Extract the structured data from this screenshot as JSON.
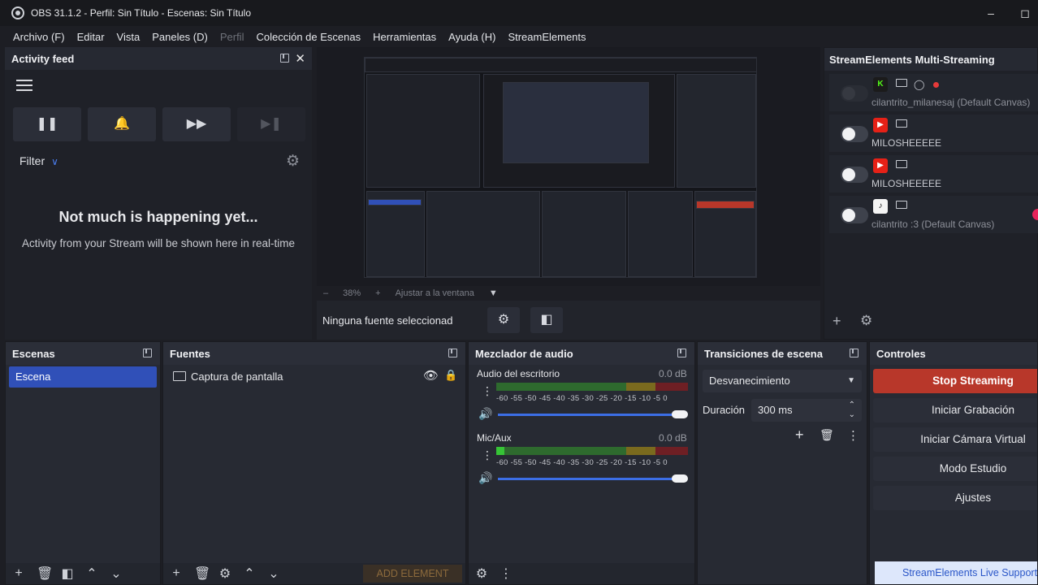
{
  "window": {
    "title": "OBS 31.1.2 - Perfil: Sin Título - Escenas: Sin Título"
  },
  "menu": [
    "Archivo (F)",
    "Editar",
    "Vista",
    "Paneles (D)",
    "Perfil",
    "Colección de Escenas",
    "Herramientas",
    "Ayuda (H)",
    "StreamElements"
  ],
  "activity": {
    "title": "Activity feed",
    "filter_label": "Filter",
    "empty_title": "Not much is happening yet...",
    "empty_sub": "Activity from your Stream will be shown here in real-time"
  },
  "preview": {
    "zoom": "38%",
    "fit": "Ajustar a la ventana",
    "no_source": "Ninguna fuente seleccionada"
  },
  "multistream": {
    "title": "StreamElements Multi-Streaming",
    "rows": [
      {
        "name": "cilantrito_milanesaj (Default Canvas)",
        "platform": "kick",
        "enabled": false
      },
      {
        "name": "MILOSHEEEEE",
        "platform": "youtube",
        "enabled": true
      },
      {
        "name": "MILOSHEEEEE",
        "platform": "youtube",
        "enabled": true
      },
      {
        "name": "cilantrito :3 (Default Canvas)",
        "platform": "tiktok",
        "enabled": true
      }
    ]
  },
  "scenes": {
    "title": "Escenas",
    "items": [
      "Escena"
    ]
  },
  "sources": {
    "title": "Fuentes",
    "items": [
      "Captura de pantalla"
    ],
    "add_element": "ADD ELEMENT"
  },
  "mixer": {
    "title": "Mezclador de audio",
    "channels": [
      {
        "name": "Audio del escritorio",
        "db": "0.0 dB",
        "level": 0.0
      },
      {
        "name": "Mic/Aux",
        "db": "0.0 dB",
        "level": 0.04
      }
    ],
    "scale": "-60 -55 -50 -45 -40 -35 -30 -25 -20 -15 -10 -5 0"
  },
  "transitions": {
    "title": "Transiciones de escena",
    "type": "Desvanecimiento",
    "duration_label": "Duración",
    "duration_value": "300 ms"
  },
  "controls": {
    "title": "Controles",
    "buttons": [
      "Stop Streaming",
      "Iniciar Grabación",
      "Iniciar Cámara Virtual",
      "Modo Estudio",
      "Ajustes"
    ],
    "support": "StreamElements Live Support"
  },
  "colors": {
    "accent": "#3050b8",
    "stop": "#b8372a",
    "youtube": "#e62117",
    "kick": "#53fc18"
  }
}
